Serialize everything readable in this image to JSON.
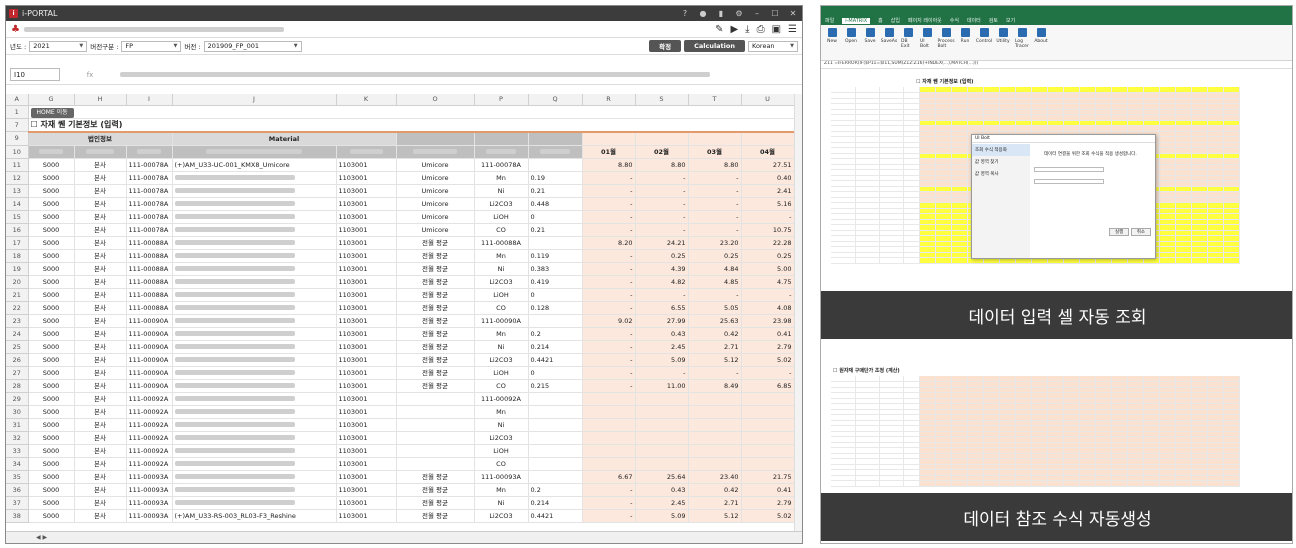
{
  "app": {
    "title": "i-PORTAL"
  },
  "window_icons": [
    "?",
    "👤",
    "▮",
    "⚙",
    "—",
    "☐",
    "✕"
  ],
  "filter": {
    "year_label": "년도 :",
    "year_value": "2021",
    "version_type_label": "버전구분 :",
    "version_type_value": "FP",
    "version_label": "버전 :",
    "version_value": "201909_FP_001",
    "confirm_btn": "확정",
    "calc_btn": "Calculation",
    "lang_value": "Korean"
  },
  "formula_bar": {
    "cell_ref": "I10",
    "fx": "fx"
  },
  "col_letters": [
    "A",
    "G",
    "H",
    "I",
    "J",
    "K",
    "O",
    "P",
    "Q",
    "R",
    "S",
    "T",
    "U"
  ],
  "sheet": {
    "home_btn": "HOME 이동",
    "section_title": "☐ 자재 퀜 기본정보 (입력)",
    "hdr_corp": "법인정보",
    "hdr_material": "Material",
    "months": [
      "01월",
      "02월",
      "03월",
      "04월"
    ],
    "rows": [
      {
        "n": "11",
        "a": "S000",
        "b": "본사",
        "c": "111-00078A",
        "d": "(+)AM_U33-UC-001_KMX8_Umicore",
        "k": "1103001",
        "o": "Umicore",
        "p": "111-00078A",
        "q": "",
        "m": [
          "8.80",
          "8.80",
          "8.80",
          "27.51"
        ]
      },
      {
        "n": "12",
        "a": "S000",
        "b": "본사",
        "c": "111-00078A",
        "d": "",
        "k": "1103001",
        "o": "Umicore",
        "p": "Mn",
        "q": "0.19",
        "m": [
          "-",
          "-",
          "-",
          "0.40"
        ]
      },
      {
        "n": "13",
        "a": "S000",
        "b": "본사",
        "c": "111-00078A",
        "d": "",
        "k": "1103001",
        "o": "Umicore",
        "p": "Ni",
        "q": "0.21",
        "m": [
          "-",
          "-",
          "-",
          "2.41"
        ]
      },
      {
        "n": "14",
        "a": "S000",
        "b": "본사",
        "c": "111-00078A",
        "d": "",
        "k": "1103001",
        "o": "Umicore",
        "p": "Li2CO3",
        "q": "0.448",
        "m": [
          "-",
          "-",
          "-",
          "5.16"
        ]
      },
      {
        "n": "15",
        "a": "S000",
        "b": "본사",
        "c": "111-00078A",
        "d": "",
        "k": "1103001",
        "o": "Umicore",
        "p": "LiOH",
        "q": "0",
        "m": [
          "-",
          "-",
          "-",
          "-"
        ]
      },
      {
        "n": "16",
        "a": "S000",
        "b": "본사",
        "c": "111-00078A",
        "d": "",
        "k": "1103001",
        "o": "Umicore",
        "p": "CO",
        "q": "0.21",
        "m": [
          "-",
          "-",
          "-",
          "10.75"
        ]
      },
      {
        "n": "17",
        "a": "S000",
        "b": "본사",
        "c": "111-00088A",
        "d": "",
        "k": "1103001",
        "o": "전월 평균",
        "p": "111-00088A",
        "q": "",
        "m": [
          "8.20",
          "24.21",
          "23.20",
          "22.28"
        ]
      },
      {
        "n": "18",
        "a": "S000",
        "b": "본사",
        "c": "111-00088A",
        "d": "",
        "k": "1103001",
        "o": "전월 평균",
        "p": "Mn",
        "q": "0.119",
        "m": [
          "-",
          "0.25",
          "0.25",
          "0.25"
        ]
      },
      {
        "n": "19",
        "a": "S000",
        "b": "본사",
        "c": "111-00088A",
        "d": "",
        "k": "1103001",
        "o": "전월 평균",
        "p": "Ni",
        "q": "0.383",
        "m": [
          "-",
          "4.39",
          "4.84",
          "5.00"
        ]
      },
      {
        "n": "20",
        "a": "S000",
        "b": "본사",
        "c": "111-00088A",
        "d": "",
        "k": "1103001",
        "o": "전월 평균",
        "p": "Li2CO3",
        "q": "0.419",
        "m": [
          "-",
          "4.82",
          "4.85",
          "4.75"
        ]
      },
      {
        "n": "21",
        "a": "S000",
        "b": "본사",
        "c": "111-00088A",
        "d": "",
        "k": "1103001",
        "o": "전월 평균",
        "p": "LiOH",
        "q": "0",
        "m": [
          "-",
          "-",
          "-",
          "-"
        ]
      },
      {
        "n": "22",
        "a": "S000",
        "b": "본사",
        "c": "111-00088A",
        "d": "",
        "k": "1103001",
        "o": "전월 평균",
        "p": "CO",
        "q": "0.128",
        "m": [
          "-",
          "6.55",
          "5.05",
          "4.08"
        ]
      },
      {
        "n": "23",
        "a": "S000",
        "b": "본사",
        "c": "111-00090A",
        "d": "",
        "k": "1103001",
        "o": "전월 평균",
        "p": "111-00090A",
        "q": "",
        "m": [
          "9.02",
          "27.99",
          "25.63",
          "23.98"
        ]
      },
      {
        "n": "24",
        "a": "S000",
        "b": "본사",
        "c": "111-00090A",
        "d": "",
        "k": "1103001",
        "o": "전월 평균",
        "p": "Mn",
        "q": "0.2",
        "m": [
          "-",
          "0.43",
          "0.42",
          "0.41"
        ]
      },
      {
        "n": "25",
        "a": "S000",
        "b": "본사",
        "c": "111-00090A",
        "d": "",
        "k": "1103001",
        "o": "전월 평균",
        "p": "Ni",
        "q": "0.214",
        "m": [
          "-",
          "2.45",
          "2.71",
          "2.79"
        ]
      },
      {
        "n": "26",
        "a": "S000",
        "b": "본사",
        "c": "111-00090A",
        "d": "",
        "k": "1103001",
        "o": "전월 평균",
        "p": "Li2CO3",
        "q": "0.4421",
        "m": [
          "-",
          "5.09",
          "5.12",
          "5.02"
        ]
      },
      {
        "n": "27",
        "a": "S000",
        "b": "본사",
        "c": "111-00090A",
        "d": "",
        "k": "1103001",
        "o": "전월 평균",
        "p": "LiOH",
        "q": "0",
        "m": [
          "-",
          "-",
          "-",
          "-"
        ]
      },
      {
        "n": "28",
        "a": "S000",
        "b": "본사",
        "c": "111-00090A",
        "d": "",
        "k": "1103001",
        "o": "전월 평균",
        "p": "CO",
        "q": "0.215",
        "m": [
          "-",
          "11.00",
          "8.49",
          "6.85"
        ]
      },
      {
        "n": "29",
        "a": "S000",
        "b": "본사",
        "c": "111-00092A",
        "d": "",
        "k": "1103001",
        "o": "",
        "p": "111-00092A",
        "q": "",
        "m": [
          "",
          "",
          "",
          ""
        ]
      },
      {
        "n": "30",
        "a": "S000",
        "b": "본사",
        "c": "111-00092A",
        "d": "",
        "k": "1103001",
        "o": "",
        "p": "Mn",
        "q": "",
        "m": [
          "",
          "",
          "",
          ""
        ]
      },
      {
        "n": "31",
        "a": "S000",
        "b": "본사",
        "c": "111-00092A",
        "d": "",
        "k": "1103001",
        "o": "",
        "p": "Ni",
        "q": "",
        "m": [
          "",
          "",
          "",
          ""
        ]
      },
      {
        "n": "32",
        "a": "S000",
        "b": "본사",
        "c": "111-00092A",
        "d": "",
        "k": "1103001",
        "o": "",
        "p": "Li2CO3",
        "q": "",
        "m": [
          "",
          "",
          "",
          ""
        ]
      },
      {
        "n": "33",
        "a": "S000",
        "b": "본사",
        "c": "111-00092A",
        "d": "",
        "k": "1103001",
        "o": "",
        "p": "LiOH",
        "q": "",
        "m": [
          "",
          "",
          "",
          ""
        ]
      },
      {
        "n": "34",
        "a": "S000",
        "b": "본사",
        "c": "111-00092A",
        "d": "",
        "k": "1103001",
        "o": "",
        "p": "CO",
        "q": "",
        "m": [
          "",
          "",
          "",
          ""
        ]
      },
      {
        "n": "35",
        "a": "S000",
        "b": "본사",
        "c": "111-00093A",
        "d": "",
        "k": "1103001",
        "o": "전월 평균",
        "p": "111-00093A",
        "q": "",
        "m": [
          "6.67",
          "25.64",
          "23.40",
          "21.75"
        ]
      },
      {
        "n": "36",
        "a": "S000",
        "b": "본사",
        "c": "111-00093A",
        "d": "",
        "k": "1103001",
        "o": "전월 평균",
        "p": "Mn",
        "q": "0.2",
        "m": [
          "-",
          "0.43",
          "0.42",
          "0.41"
        ]
      },
      {
        "n": "37",
        "a": "S000",
        "b": "본사",
        "c": "111-00093A",
        "d": "",
        "k": "1103001",
        "o": "전월 평균",
        "p": "Ni",
        "q": "0.214",
        "m": [
          "-",
          "2.45",
          "2.71",
          "2.79"
        ]
      },
      {
        "n": "38",
        "a": "S000",
        "b": "본사",
        "c": "111-00093A",
        "d": "(+)AM_U33-RS-003_RL03-F3_Reshine",
        "k": "1103001",
        "o": "전월 평균",
        "p": "Li2CO3",
        "q": "0.4421",
        "m": [
          "-",
          "5.09",
          "5.12",
          "5.02"
        ]
      }
    ]
  },
  "right": {
    "caption1": "데이터 입력 셀 자동 조회",
    "caption2": "데이터 참조 수식 자동생성",
    "ribbon_tabs": [
      "파일",
      "i-MATRIX",
      "홈",
      "삽입",
      "페이지 레이아웃",
      "수식",
      "데이터",
      "검토",
      "보기"
    ],
    "ribbon_btns": [
      "New",
      "Open",
      "Save",
      "SaveAs",
      "DB Exit",
      "UI Bolt",
      "Process Bolt",
      "Run",
      "Control",
      "Utility",
      "Log Tracer",
      "About"
    ],
    "dialog_title": "UI Bolt",
    "dialog_items": [
      "조회 수식 적용화",
      "값 영역 찾기",
      "값 영역 복사"
    ],
    "dialog_msg": "데이터 연결을 위한 조회 수식을 적용 생성합니다.",
    "dialog_ok": "실행",
    "dialog_cancel": "취소",
    "mini_title1": "☐ 자재 퀜 기본정보 (입력)",
    "mini_title2": "☐ 원자재 구매단가 조정 (계산)"
  }
}
